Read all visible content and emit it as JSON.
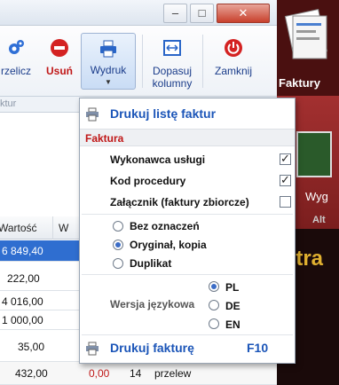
{
  "ribbon": {
    "przelicz_label": "rzelicz",
    "usun_label": "Usuń",
    "wydruk_label": "Wydruk",
    "dopasuj_label": "Dopasuj kolumny",
    "zamknij_label": "Zamknij",
    "group_label": "ktur"
  },
  "titlebar": {
    "minimize": "–",
    "maximize": "□"
  },
  "grid": {
    "headers": [
      "Wartość",
      "W"
    ],
    "rows": [
      {
        "value": "6 849,40",
        "selected": true
      },
      {
        "value": "222,00"
      },
      {
        "value": "4 016,00"
      },
      {
        "value": "1 000,00"
      },
      {
        "value": "35,00"
      },
      {
        "value": "432,00",
        "extra_value": "0,00",
        "extra_num": "14",
        "payment": "przelew"
      }
    ]
  },
  "side": {
    "faktury_label": "Faktury",
    "wyg_label": "Wyg",
    "alt_label": "Alt",
    "stra_label": "stra"
  },
  "menu": {
    "print_list_label": "Drukuj listę faktur",
    "section_label": "Faktura",
    "options": [
      {
        "label": "Wykonawca usługi",
        "checked": true
      },
      {
        "label": "Kod procedury",
        "checked": true
      },
      {
        "label": "Załącznik (faktury zbiorcze)",
        "checked": false
      }
    ],
    "marks": [
      {
        "label": "Bez oznaczeń",
        "selected": false
      },
      {
        "label": "Oryginał, kopia",
        "selected": true
      },
      {
        "label": "Duplikat",
        "selected": false
      }
    ],
    "language_label": "Wersja językowa",
    "languages": [
      {
        "label": "PL",
        "selected": true
      },
      {
        "label": "DE",
        "selected": false
      },
      {
        "label": "EN",
        "selected": false
      }
    ],
    "print_invoice_label": "Drukuj fakturę",
    "print_invoice_shortcut": "F10"
  }
}
